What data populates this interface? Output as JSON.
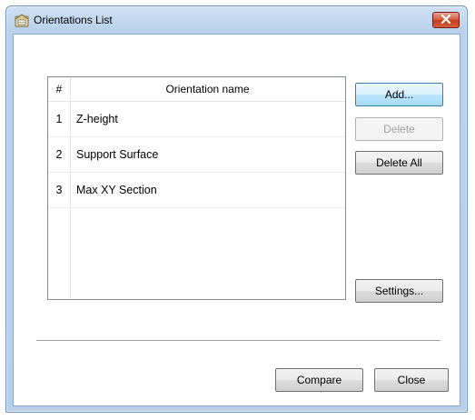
{
  "window": {
    "title": "Orientations List"
  },
  "list": {
    "columns": [
      "#",
      "Orientation name"
    ],
    "rows": [
      {
        "num": "1",
        "name": "Z-height"
      },
      {
        "num": "2",
        "name": "Support Surface"
      },
      {
        "num": "3",
        "name": "Max XY Section"
      }
    ]
  },
  "buttons": {
    "add": "Add...",
    "delete": "Delete",
    "delete_all": "Delete All",
    "settings": "Settings...",
    "compare": "Compare",
    "close": "Close"
  },
  "colors": {
    "title_bar": "#bcd2ec",
    "close_button": "#c43a1e",
    "default_button": "#bee6fd"
  },
  "icons": {
    "app": "application-icon",
    "close": "close-icon"
  }
}
